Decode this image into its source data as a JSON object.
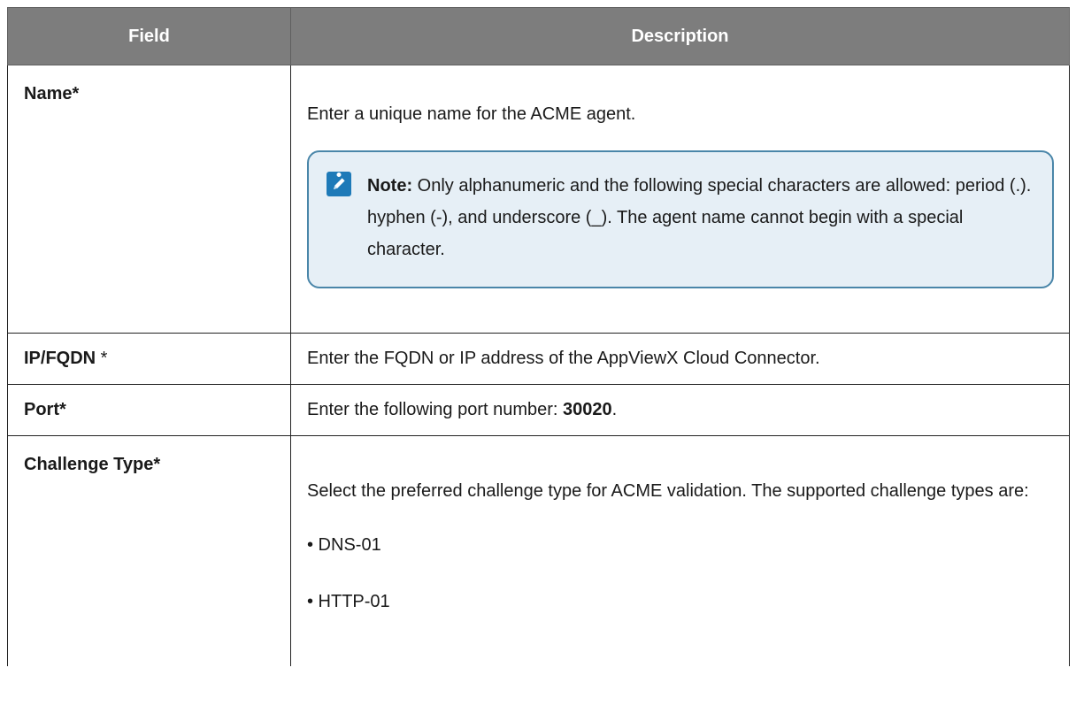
{
  "table": {
    "headers": {
      "field": "Field",
      "description": "Description"
    },
    "rows": {
      "name": {
        "field": "Name*",
        "description": "Enter a unique name for the ACME agent.",
        "note": {
          "label": "Note:",
          "text": " Only alphanumeric and the following special characters are allowed: period (.). hyphen (-), and underscore (_). The agent name cannot begin with a special character."
        }
      },
      "ip": {
        "field": "IP/FQDN",
        "field_suffix": " *",
        "description": "Enter the FQDN or IP address of the AppViewX Cloud Connector."
      },
      "port": {
        "field": "Port*",
        "description_prefix": "Enter the following port number: ",
        "description_value": "30020",
        "description_suffix": "."
      },
      "challenge": {
        "field": "Challenge Type*",
        "description": "Select the preferred challenge type for ACME validation. The supported challenge types are:",
        "options": [
          "• DNS-01",
          "• HTTP-01"
        ]
      }
    }
  },
  "colors": {
    "header_bg": "#7d7d7d",
    "note_bg": "#e6eff6",
    "note_border": "#4a86a9",
    "note_icon": "#1e7ab8"
  },
  "icons": {
    "note": "pencil-edit-icon"
  }
}
